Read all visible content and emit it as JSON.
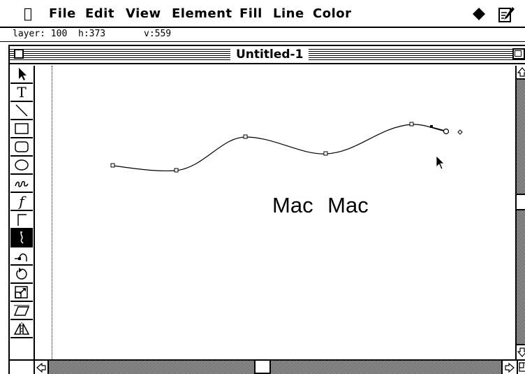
{
  "menubar": {
    "apple": "",
    "items": [
      "File",
      "Edit",
      "View",
      "Element",
      "Fill",
      "Line",
      "Color"
    ],
    "right_icons": [
      "diamond-icon",
      "note-pencil-icon"
    ]
  },
  "info": {
    "layer": "layer: 100",
    "h": "h:373",
    "v": "v:559"
  },
  "window": {
    "title": "Untitled-1"
  },
  "tools": [
    {
      "name": "arrow-tool",
      "icon": "arrow-icon"
    },
    {
      "name": "text-tool",
      "icon": "text-icon",
      "glyph": "T"
    },
    {
      "name": "line-tool",
      "icon": "line-icon"
    },
    {
      "name": "rectangle-tool",
      "icon": "rectangle-icon"
    },
    {
      "name": "rounded-rectangle-tool",
      "icon": "rounded-rectangle-icon"
    },
    {
      "name": "oval-tool",
      "icon": "oval-icon"
    },
    {
      "name": "freehand-tool",
      "icon": "freehand-icon"
    },
    {
      "name": "curve-tool",
      "icon": "curve-f-icon",
      "glyph": "f"
    },
    {
      "name": "corner-tool",
      "icon": "corner-icon"
    },
    {
      "name": "bezier-tool",
      "icon": "bezier-icon",
      "selected": true
    },
    {
      "name": "connector-tool",
      "icon": "connector-icon"
    },
    {
      "name": "rotate-tool",
      "icon": "rotate-icon"
    },
    {
      "name": "scale-tool",
      "icon": "scale-icon"
    },
    {
      "name": "skew-tool",
      "icon": "skew-icon"
    },
    {
      "name": "reflect-tool",
      "icon": "reflect-icon"
    }
  ],
  "canvas": {
    "text": "Mac  Mac"
  },
  "scrollbars": {
    "up_icon": "scroll-up-arrow-icon",
    "down_icon": "scroll-down-arrow-icon",
    "left_icon": "scroll-left-arrow-icon",
    "right_icon": "scroll-right-arrow-icon"
  }
}
